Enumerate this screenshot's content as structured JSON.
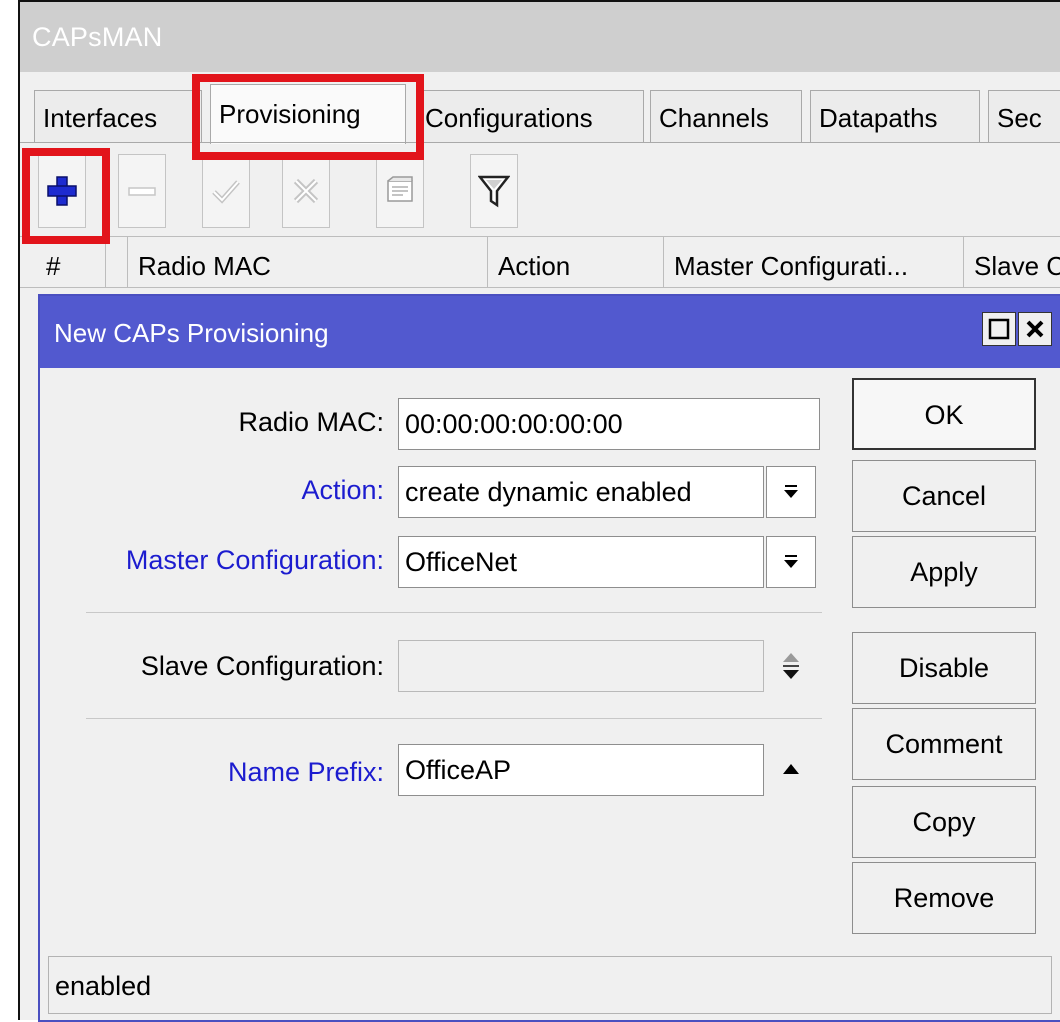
{
  "window": {
    "title": "CAPsMAN"
  },
  "tabs": [
    {
      "label": "Interfaces"
    },
    {
      "label": "Provisioning",
      "active": true
    },
    {
      "label": "Configurations"
    },
    {
      "label": "Channels"
    },
    {
      "label": "Datapaths"
    },
    {
      "label": "Sec"
    }
  ],
  "toolbar": {
    "buttons": [
      {
        "icon": "plus-icon"
      },
      {
        "icon": "minus-icon"
      },
      {
        "icon": "check-icon"
      },
      {
        "icon": "cross-icon"
      },
      {
        "icon": "comment-icon"
      },
      {
        "icon": "filter-icon"
      }
    ]
  },
  "table": {
    "columns": [
      "#",
      "Radio MAC",
      "Action",
      "Master Configurati...",
      "Slave C"
    ]
  },
  "dialog": {
    "title": "New CAPs Provisioning",
    "fields": {
      "radio_mac": {
        "label": "Radio MAC:",
        "value": "00:00:00:00:00:00"
      },
      "action": {
        "label": "Action:",
        "value": "create dynamic enabled"
      },
      "master_configuration": {
        "label": "Master Configuration:",
        "value": "OfficeNet"
      },
      "slave_configuration": {
        "label": "Slave Configuration:",
        "value": ""
      },
      "name_prefix": {
        "label": "Name Prefix:",
        "value": "OfficeAP"
      }
    },
    "buttons": {
      "ok": "OK",
      "cancel": "Cancel",
      "apply": "Apply",
      "disable": "Disable",
      "comment": "Comment",
      "copy": "Copy",
      "remove": "Remove"
    },
    "status": "enabled"
  },
  "colors": {
    "highlight": "#e2141b",
    "dialog_title": "#5259cf",
    "link_label": "#1c1ccf",
    "plus_icon": "#1d2bd0"
  }
}
